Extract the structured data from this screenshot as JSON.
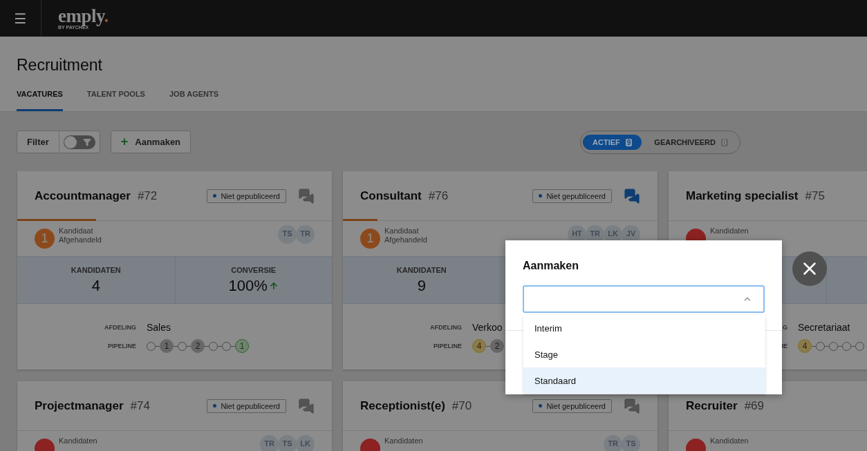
{
  "topbar": {
    "menu_icon": "☰",
    "logo": {
      "name": "emply",
      "dot": ".",
      "sub": "BY PAYCHEX"
    }
  },
  "page": {
    "title": "Recruitment"
  },
  "tabs": [
    {
      "label": "VACATURES",
      "selected": true
    },
    {
      "label": "TALENT POOLS",
      "selected": false
    },
    {
      "label": "JOB AGENTS",
      "selected": false
    }
  ],
  "toolbar": {
    "filter": {
      "label": "Filter",
      "on": false
    },
    "create": {
      "icon": "+",
      "label": "Aanmaken"
    }
  },
  "segments": [
    {
      "label": "ACTIEF",
      "count": "9",
      "selected": true
    },
    {
      "label": "GEARCHIVEERD",
      "count": "0",
      "selected": false
    }
  ],
  "cards": [
    {
      "title": "Accountmanager",
      "number": "#72",
      "badge": "Niet gepubliceerd",
      "has_messages": false,
      "level": 0.25,
      "handled": {
        "count": "1",
        "color": "#8c4a1c",
        "lines": [
          "Kandidaat",
          "Afgehandeld"
        ]
      },
      "avatars": [
        "TS",
        "TR"
      ],
      "stats": [
        {
          "label": "KANDIDATEN",
          "value": "4"
        },
        {
          "label": "CONVERSIE",
          "value": "100%",
          "rising": true
        }
      ],
      "details": [
        {
          "label": "AFDELING",
          "value": "Sales"
        }
      ],
      "pipeline_label": "PIPELINE",
      "pipeline": [
        {
          "kind": "empty"
        },
        {
          "kind": "gray",
          "count": "1"
        },
        {
          "kind": "empty"
        },
        {
          "kind": "gray",
          "count": "2"
        },
        {
          "kind": "empty"
        },
        {
          "kind": "empty"
        },
        {
          "kind": "green",
          "count": "1"
        }
      ]
    },
    {
      "title": "Consultant",
      "number": "#76",
      "badge": "Niet gepubliceerd",
      "has_messages": true,
      "level": 0.11,
      "handled": {
        "count": "1",
        "color": "#8c4a1c",
        "lines": [
          "Kandidaat",
          "Afgehandeld"
        ]
      },
      "avatars": [
        "HT",
        "TR",
        "LK",
        "JV"
      ],
      "stats": [
        {
          "label": "KANDIDATEN",
          "value": "9"
        }
      ],
      "details": [
        {
          "label": "AFDELING",
          "value": "Verkoo"
        }
      ],
      "pipeline_label": "PIPELINE",
      "pipeline": [
        {
          "kind": "yellow",
          "count": "4"
        },
        {
          "kind": "gray",
          "count": "2"
        }
      ]
    },
    {
      "title": "Marketing specialist",
      "number": "#75",
      "handled": {
        "color": "#8c2222",
        "lines": [
          "Kandidaten"
        ]
      },
      "details": [
        {
          "label": "G",
          "value": "Secretariaat"
        }
      ],
      "pipeline_label": "IE",
      "pipeline": [
        {
          "kind": "yellow",
          "count": "4"
        },
        {
          "kind": "empty"
        },
        {
          "kind": "empty"
        },
        {
          "kind": "empty"
        },
        {
          "kind": "empty"
        }
      ]
    },
    {
      "title": "Projectmanager",
      "number": "#74",
      "badge": "Niet gepubliceerd",
      "has_messages": false,
      "handled": {
        "color": "#8c2222",
        "lines": [
          "Kandidaten"
        ]
      },
      "avatars": [
        "TR",
        "TS",
        "LK"
      ]
    },
    {
      "title": "Receptionist(e)",
      "number": "#70",
      "badge": "Niet gepubliceerd",
      "has_messages": false,
      "handled": {
        "color": "#8c2222",
        "lines": [
          "Kandidaten"
        ]
      },
      "avatars": [
        "TR",
        "TS"
      ]
    },
    {
      "title": "Recruiter",
      "number": "#69",
      "handled": {
        "color": "#8c2222",
        "lines": [
          "Kandidaten"
        ]
      }
    }
  ],
  "modal": {
    "title": "Aanmaken",
    "select": {
      "expanded": true,
      "options": [
        {
          "label": "Interim",
          "selected": false
        },
        {
          "label": "Stage",
          "selected": false
        },
        {
          "label": "Standaard",
          "selected": true
        }
      ]
    }
  }
}
